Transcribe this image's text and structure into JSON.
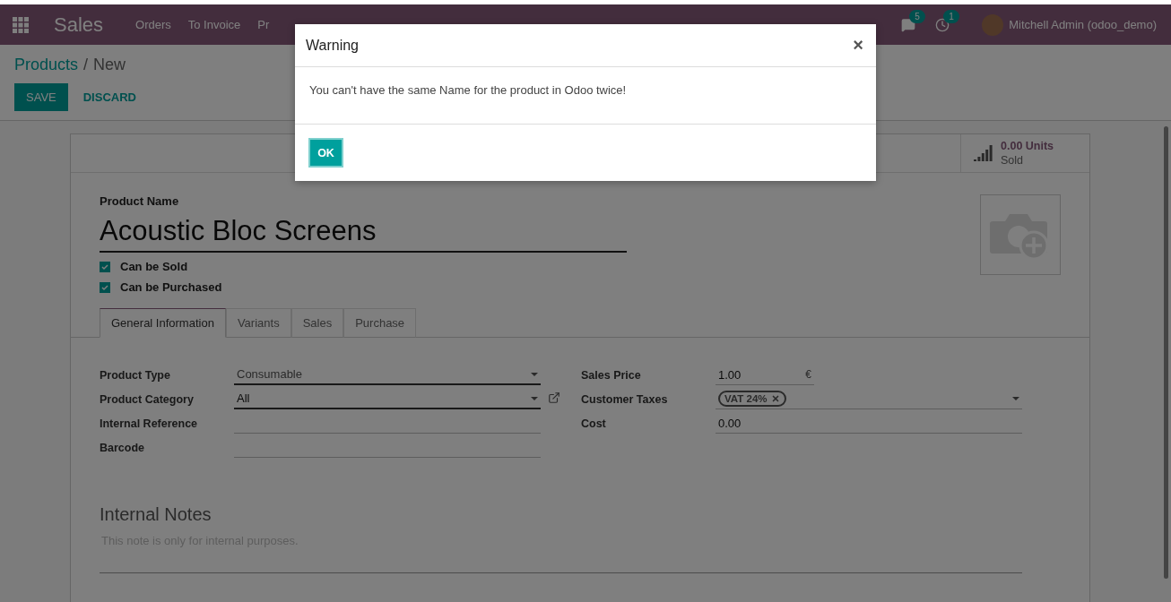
{
  "app": {
    "title": "Sales",
    "menu": [
      "Orders",
      "To Invoice",
      "Pr"
    ],
    "user": "Mitchell Admin (odoo_demo)",
    "notifications": [
      {
        "kind": "messages",
        "count": "5"
      },
      {
        "kind": "activities",
        "count": "1"
      }
    ]
  },
  "breadcrumb": {
    "parent": "Products",
    "separator": "/",
    "current": "New"
  },
  "actions": [
    {
      "kind": "primary",
      "label": "SAVE"
    },
    {
      "kind": "link",
      "label": "DISCARD"
    }
  ],
  "stat_button": {
    "value": "0.00 Units",
    "label": "Sold"
  },
  "product": {
    "name_label": "Product Name",
    "name": "Acoustic Bloc Screens",
    "options": [
      {
        "label": "Can be Sold",
        "checked": true
      },
      {
        "label": "Can be Purchased",
        "checked": true
      }
    ]
  },
  "tabs": [
    {
      "label": "General Information",
      "selected": true
    },
    {
      "label": "Variants",
      "selected": false
    },
    {
      "label": "Sales",
      "selected": false
    },
    {
      "label": "Purchase",
      "selected": false
    }
  ],
  "left_fields": [
    {
      "kind": "select",
      "label": "Product Type",
      "value": "Consumable"
    },
    {
      "kind": "many2one",
      "label": "Product Category",
      "value": "All"
    },
    {
      "kind": "text",
      "label": "Internal Reference"
    },
    {
      "kind": "text",
      "label": "Barcode"
    }
  ],
  "right_fields": [
    {
      "kind": "monetary",
      "label": "Sales Price",
      "value": "1.00",
      "suffix": "€"
    },
    {
      "kind": "tags",
      "label": "Customer Taxes",
      "tags": [
        "VAT 24%"
      ]
    },
    {
      "kind": "text",
      "label": "Cost",
      "value": "0.00"
    }
  ],
  "notes": {
    "title": "Internal Notes",
    "placeholder": "This note is only for internal purposes."
  },
  "dialog": {
    "title": "Warning",
    "close": "×",
    "message": "You can't have the same Name for the product in Odoo twice!",
    "button": "OK"
  }
}
